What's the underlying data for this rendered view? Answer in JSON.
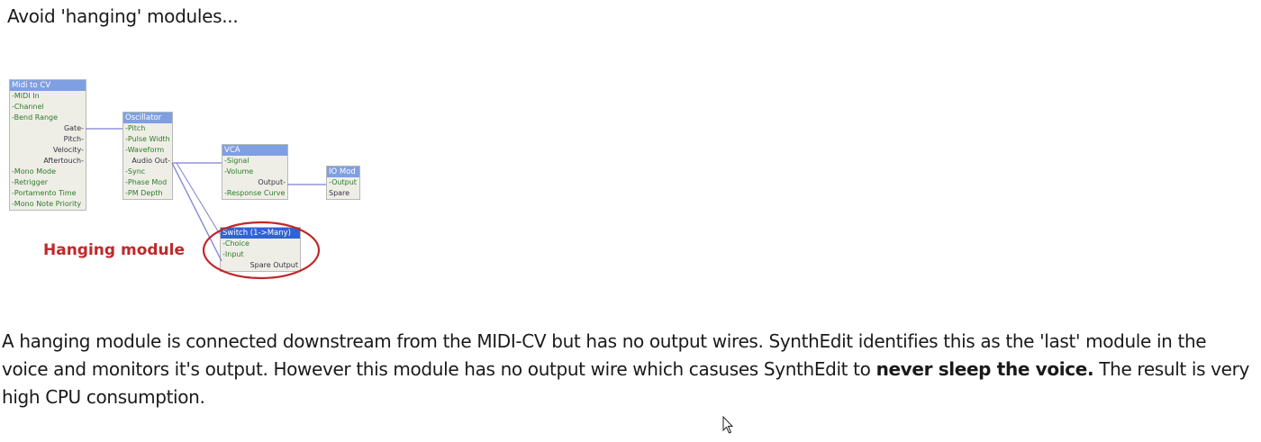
{
  "heading": "Avoid 'hanging' modules...",
  "modules": {
    "midi_cv": {
      "title": "Midi to CV",
      "pins": [
        "-MIDI In",
        "-Channel",
        "-Bend Range",
        "Gate-",
        "Pitch-",
        "Velocity-",
        "Aftertouch-",
        "-Mono Mode",
        "-Retrigger",
        "-Portamento Time",
        "-Mono Note Priority"
      ]
    },
    "oscillator": {
      "title": "Oscillator",
      "pins": [
        "-Pitch",
        "-Pulse Width",
        "-Waveform",
        "Audio Out-",
        "-Sync",
        "-Phase Mod",
        "-PM Depth"
      ]
    },
    "vca": {
      "title": "VCA",
      "pins": [
        "-Signal",
        "-Volume",
        "Output-",
        "-Response Curve"
      ]
    },
    "io_mod": {
      "title": "IO Mod",
      "pins": [
        "-Output",
        "Spare"
      ]
    },
    "switch": {
      "title": "Switch (1->Many)",
      "pins": [
        "-Choice",
        "-Input",
        "Spare Output"
      ]
    }
  },
  "hanging_label": "Hanging module",
  "paragraph": {
    "text_1": "A hanging module is connected downstream from the MIDI-CV but has no output wires.  SynthEdit identifies this as the 'last' module in the voice and monitors it's output.  However this module has no output wire which casuses SynthEdit to ",
    "bold_1": "never sleep the voice.",
    "text_2": " The result is very high CPU consumption."
  },
  "colors": {
    "module_title": "#7f9fe2",
    "selected_title": "#2f63d6",
    "wire": "#7d7fd6",
    "highlight": "#c0282b"
  }
}
